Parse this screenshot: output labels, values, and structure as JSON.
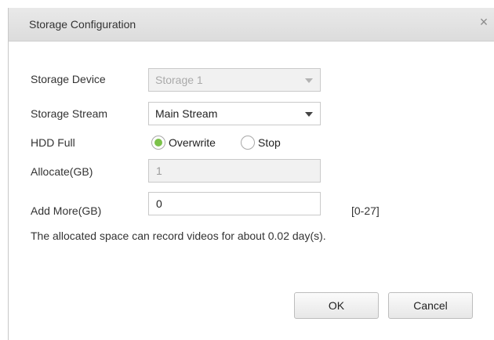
{
  "dialog": {
    "title": "Storage Configuration",
    "close_glyph": "×"
  },
  "form": {
    "storage_device": {
      "label": "Storage Device",
      "value": "Storage 1",
      "disabled": true
    },
    "storage_stream": {
      "label": "Storage Stream",
      "value": "Main Stream"
    },
    "hdd_full": {
      "label": "HDD Full",
      "options": [
        {
          "label": "Overwrite",
          "selected": true
        },
        {
          "label": "Stop",
          "selected": false
        }
      ]
    },
    "allocate": {
      "label": "Allocate(GB)",
      "value": "1",
      "disabled": true
    },
    "add_more": {
      "label": "Add More(GB)",
      "value": "0",
      "range": "[0-27]"
    },
    "info_text": "The allocated space can record videos for about 0.02 day(s)."
  },
  "buttons": {
    "ok": "OK",
    "cancel": "Cancel"
  },
  "colors": {
    "radio_selected": "#7cc24a",
    "titlebar": "#dedede"
  }
}
